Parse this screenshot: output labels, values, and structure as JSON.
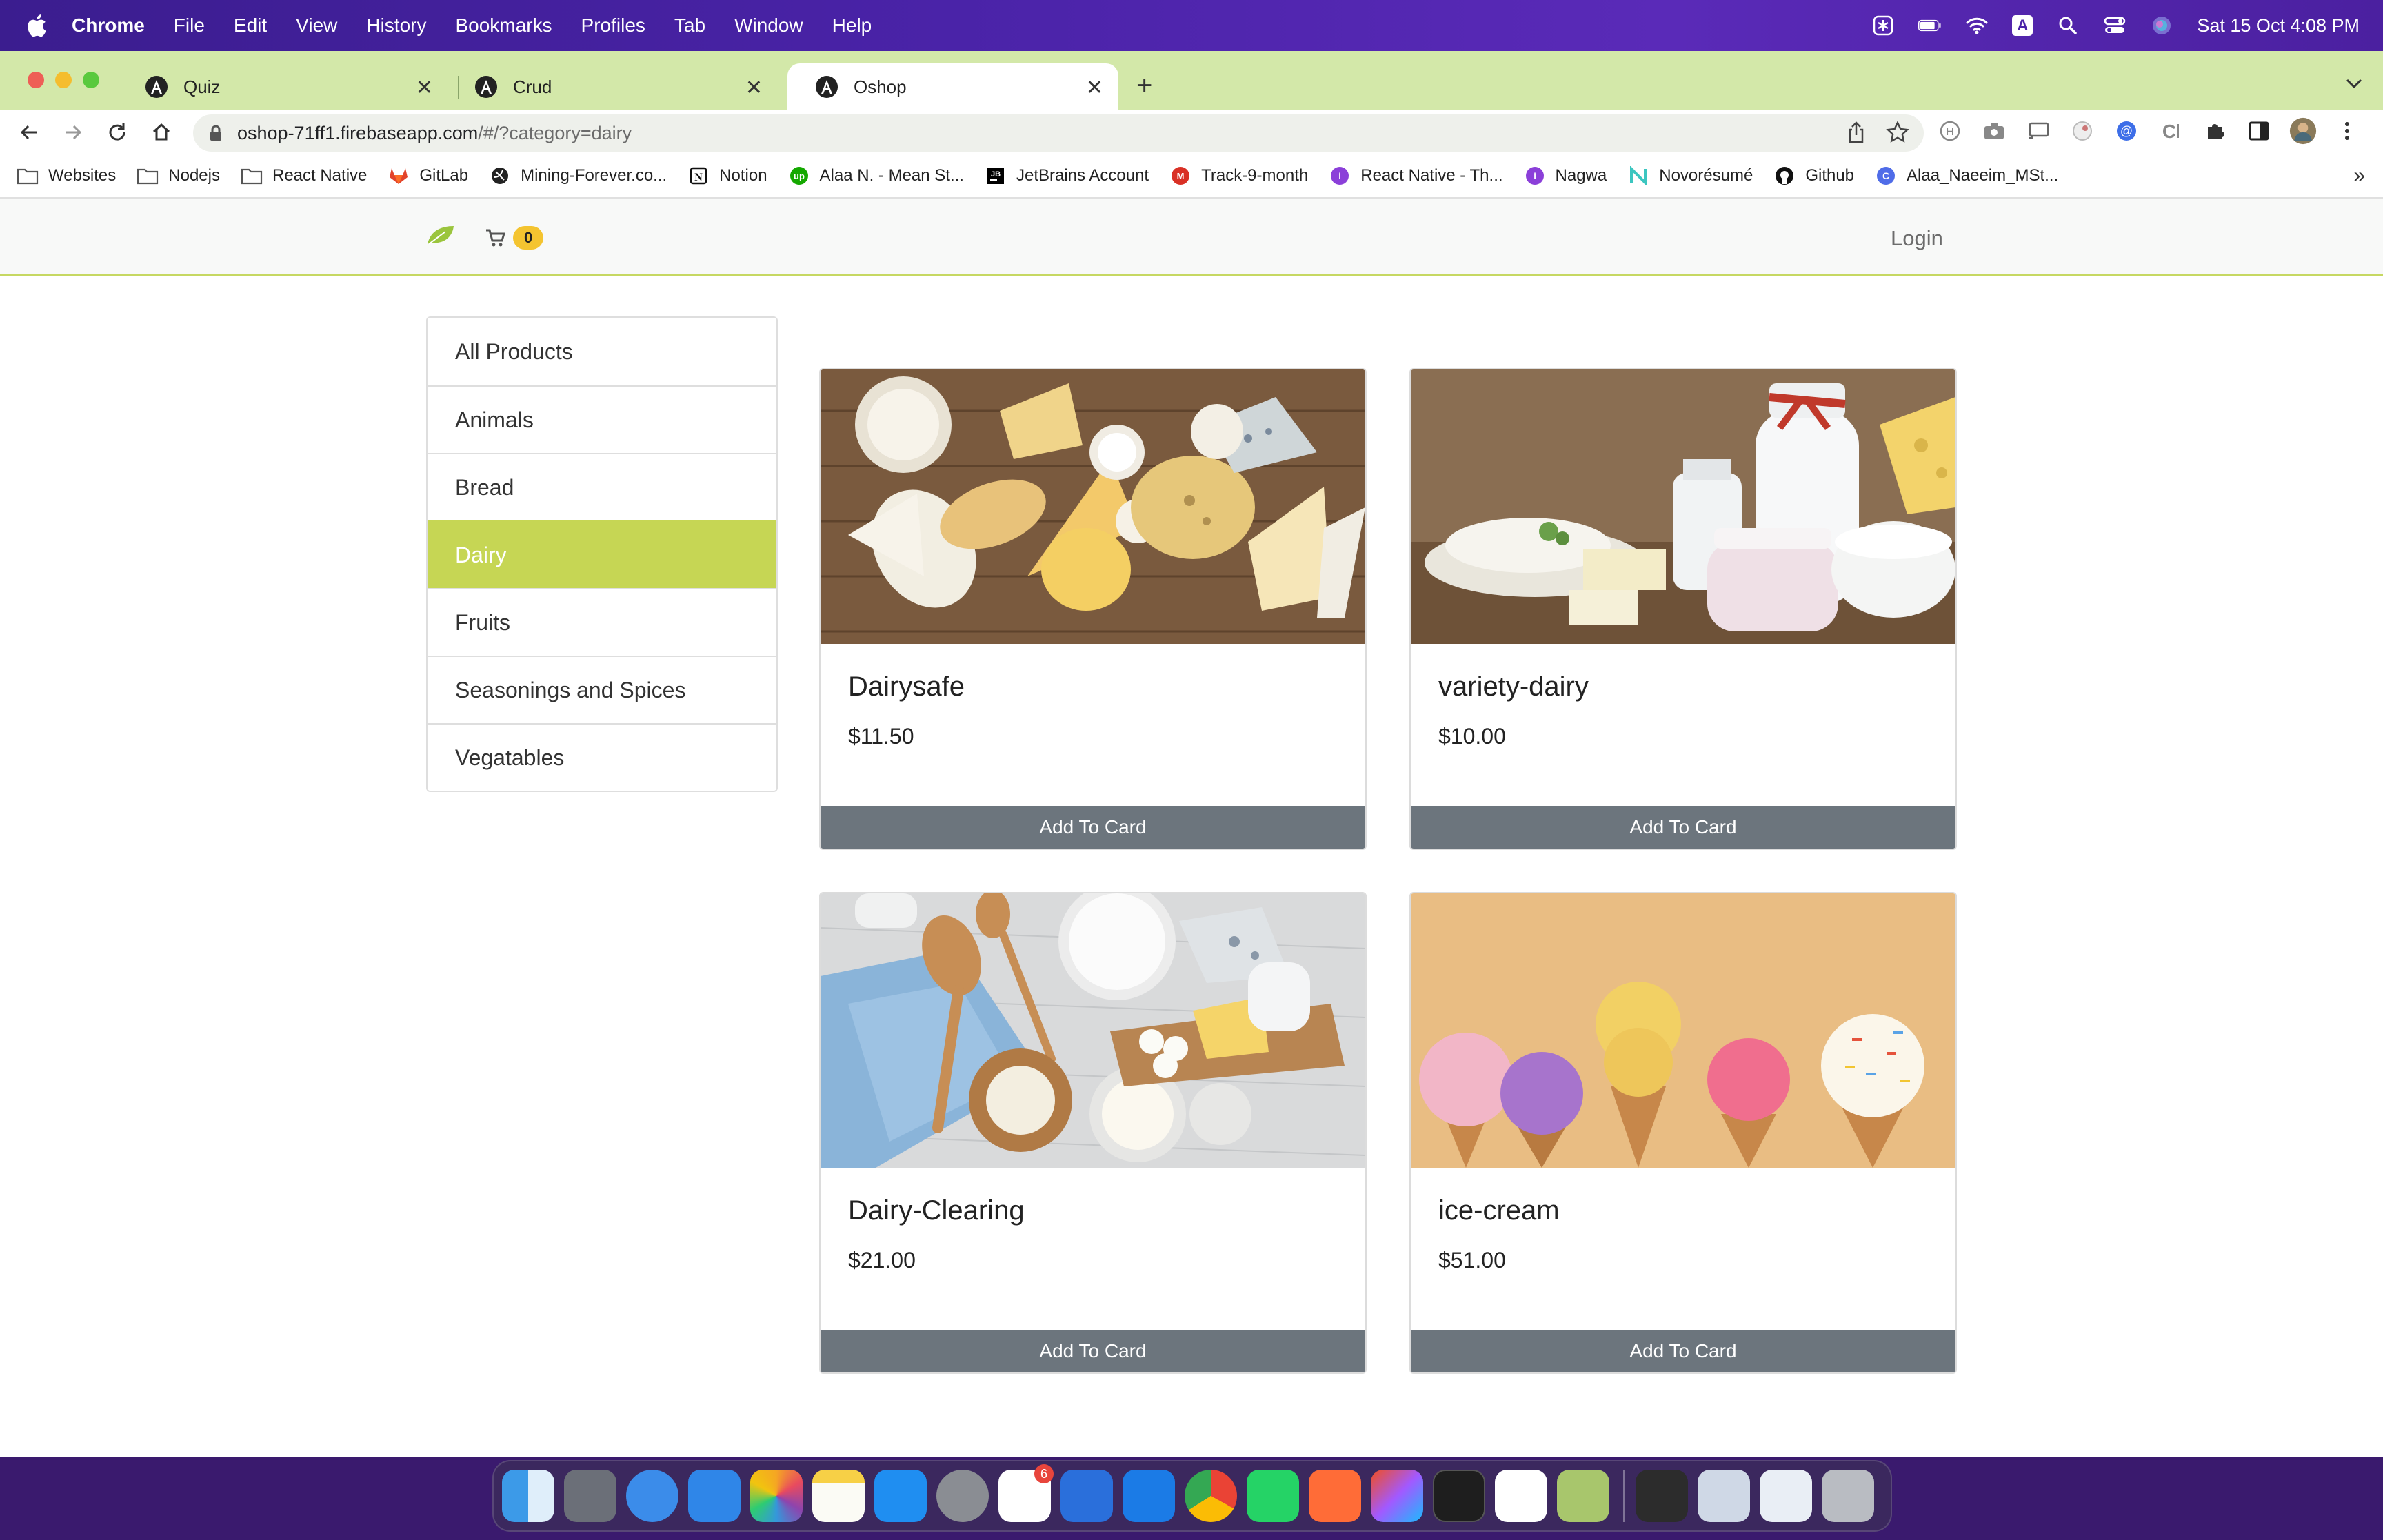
{
  "menubar": {
    "app_name": "Chrome",
    "menus": [
      "File",
      "Edit",
      "View",
      "History",
      "Bookmarks",
      "Profiles",
      "Tab",
      "Window",
      "Help"
    ],
    "datetime": "Sat 15 Oct  4:08 PM",
    "input_source": "A"
  },
  "tabs": [
    {
      "title": "Quiz",
      "active": false
    },
    {
      "title": "Crud",
      "active": false
    },
    {
      "title": "Oshop",
      "active": true
    }
  ],
  "address_bar": {
    "url_host": "oshop-71ff1.firebaseapp.com",
    "url_rest": "/#/?category=dairy"
  },
  "bookmarks": [
    {
      "label": "Websites",
      "icon": "folder-icon"
    },
    {
      "label": "Nodejs",
      "icon": "folder-icon"
    },
    {
      "label": "React Native",
      "icon": "folder-icon"
    },
    {
      "label": "GitLab",
      "icon": "gitlab-icon"
    },
    {
      "label": "Mining-Forever.co...",
      "icon": "globe-icon"
    },
    {
      "label": "Notion",
      "icon": "notion-icon"
    },
    {
      "label": "Alaa N. - Mean St...",
      "icon": "upwork-icon"
    },
    {
      "label": "JetBrains Account",
      "icon": "jetbrains-icon"
    },
    {
      "label": "Track-9-month",
      "icon": "gmail-icon"
    },
    {
      "label": "React Native - Th...",
      "icon": "iti-icon"
    },
    {
      "label": "Nagwa",
      "icon": "iti-icon"
    },
    {
      "label": "Novorésumé",
      "icon": "novoresume-icon"
    },
    {
      "label": "Github",
      "icon": "github-icon"
    },
    {
      "label": "Alaa_Naeeim_MSt...",
      "icon": "canva-icon"
    }
  ],
  "bookmarks_more": "»",
  "site": {
    "cart_count": "0",
    "login_label": "Login",
    "categories": [
      {
        "label": "All Products",
        "active": false
      },
      {
        "label": "Animals",
        "active": false
      },
      {
        "label": "Bread",
        "active": false
      },
      {
        "label": "Dairy",
        "active": true
      },
      {
        "label": "Fruits",
        "active": false
      },
      {
        "label": "Seasonings and Spices",
        "active": false
      },
      {
        "label": "Vegatables",
        "active": false
      }
    ],
    "products": [
      {
        "title": "Dairysafe",
        "price": "$11.50",
        "button": "Add To Card"
      },
      {
        "title": "variety-dairy",
        "price": "$10.00",
        "button": "Add To Card"
      },
      {
        "title": "Dairy-Clearing",
        "price": "$21.00",
        "button": "Add To Card"
      },
      {
        "title": "ice-cream",
        "price": "$51.00",
        "button": "Add To Card"
      }
    ]
  },
  "colors": {
    "tabstrip": "#d3e8a9",
    "accent_green": "#c6d654",
    "badge_yellow": "#f4c430",
    "button_gray": "#6c757d"
  },
  "dock": {
    "slack_badge": "6"
  }
}
